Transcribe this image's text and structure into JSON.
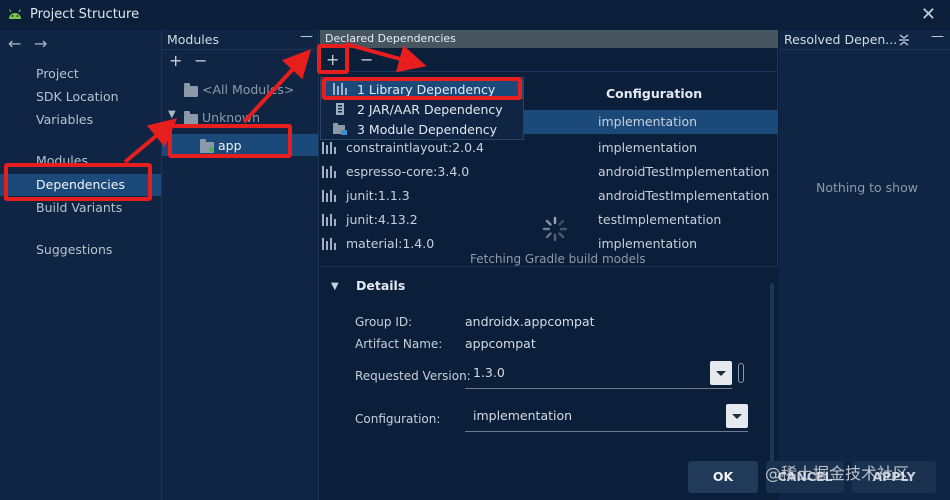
{
  "window": {
    "title": "Project Structure",
    "close_glyph": "✕"
  },
  "nav": {
    "back_glyph": "←",
    "forward_glyph": "→",
    "items": [
      "Project",
      "SDK Location",
      "Variables",
      "Modules",
      "Dependencies",
      "Build Variants",
      "Suggestions"
    ],
    "selected": "Dependencies"
  },
  "modules": {
    "title": "Modules",
    "collapse_glyph": "—",
    "add_glyph": "+",
    "remove_glyph": "−",
    "tree": [
      "<All Modules>",
      "Unknown",
      "app"
    ]
  },
  "declared": {
    "title": "Declared Dependencies",
    "add_glyph": "+",
    "remove_glyph": "−",
    "configuration_header": "Configuration",
    "rows": [
      {
        "name": "",
        "configuration": "implementation"
      },
      {
        "name": "constraintlayout:2.0.4",
        "configuration": "implementation"
      },
      {
        "name": "espresso-core:3.4.0",
        "configuration": "androidTestImplementation"
      },
      {
        "name": "junit:1.1.3",
        "configuration": "androidTestImplementation"
      },
      {
        "name": "junit:4.13.2",
        "configuration": "testImplementation"
      },
      {
        "name": "material:1.4.0",
        "configuration": "implementation"
      }
    ],
    "loading_text": "Fetching Gradle build models"
  },
  "popup_menu": {
    "items": [
      "1  Library Dependency",
      "2  JAR/AAR Dependency",
      "3  Module Dependency"
    ],
    "active_index": 0
  },
  "details": {
    "title": "Details",
    "group_id_label": "Group ID:",
    "group_id": "androidx.appcompat",
    "artifact_label": "Artifact Name:",
    "artifact": "appcompat",
    "version_label": "Requested Version:",
    "version": "1.3.0",
    "config_label": "Configuration:",
    "configuration": "implementation"
  },
  "resolved": {
    "title": "Resolved Depen...",
    "empty_text": "Nothing to show",
    "collapse_glyph": "—"
  },
  "buttons": {
    "ok": "OK",
    "cancel": "CANCEL",
    "apply": "APPLY"
  },
  "watermark": "@稀土掘金技术社区",
  "colors": {
    "background": "#0c1f3a",
    "selection": "#1b4a7a",
    "annotation_red": "#e61e1e",
    "panel_header": "#475561"
  }
}
